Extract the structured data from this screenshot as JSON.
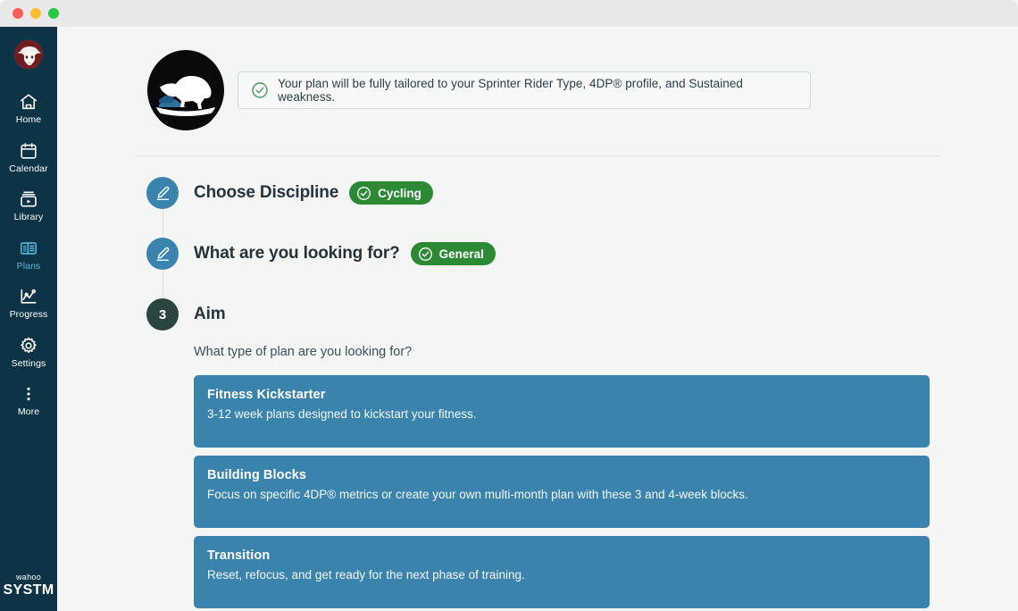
{
  "window": {
    "traffic_lights": [
      "close",
      "minimize",
      "zoom"
    ]
  },
  "sidebar": {
    "avatar_name": "user-avatar-goat",
    "brand_line1": "wahoo",
    "brand_line2": "SYSTM",
    "active_item": "Plans",
    "items": [
      {
        "label": "Home",
        "icon": "home-icon"
      },
      {
        "label": "Calendar",
        "icon": "calendar-icon"
      },
      {
        "label": "Library",
        "icon": "library-icon"
      },
      {
        "label": "Plans",
        "icon": "plans-icon"
      },
      {
        "label": "Progress",
        "icon": "progress-icon"
      },
      {
        "label": "Settings",
        "icon": "gear-icon"
      },
      {
        "label": "More",
        "icon": "more-dots-icon"
      }
    ]
  },
  "header": {
    "logo_name": "wahoo-sufferfest-logo",
    "alert": {
      "icon": "check-circle-icon",
      "text": "Your plan will be fully tailored to your Sprinter Rider Type, 4DP® profile, and Sustained weakness."
    }
  },
  "steps": [
    {
      "bullet_type": "edit",
      "bullet_icon": "pencil-icon",
      "title": "Choose Discipline",
      "pill": {
        "label": "Cycling",
        "icon": "check-circle-icon",
        "color": "#2b8a33"
      }
    },
    {
      "bullet_type": "edit",
      "bullet_icon": "pencil-icon",
      "title": "What are you looking for?",
      "pill": {
        "label": "General",
        "icon": "check-circle-icon",
        "color": "#2b8a33"
      }
    },
    {
      "bullet_type": "number",
      "bullet_label": "3",
      "title": "Aim",
      "subtitle": "What type of plan are you looking for?"
    }
  ],
  "options": [
    {
      "title": "Fitness Kickstarter",
      "desc": "3-12 week plans designed to kickstart your fitness."
    },
    {
      "title": "Building Blocks",
      "desc": "Focus on specific 4DP® metrics or create your own multi-month plan with these 3 and 4-week blocks."
    },
    {
      "title": "Transition",
      "desc": "Reset, refocus, and get ready for the next phase of training."
    }
  ],
  "colors": {
    "sidebar_bg": "#0d3446",
    "page_bg": "#f4f5f5",
    "accent_blue": "#3a83ad",
    "accent_green": "#2b8a33",
    "active_nav": "#5db6e0",
    "step_number_bg": "#2c4440"
  }
}
